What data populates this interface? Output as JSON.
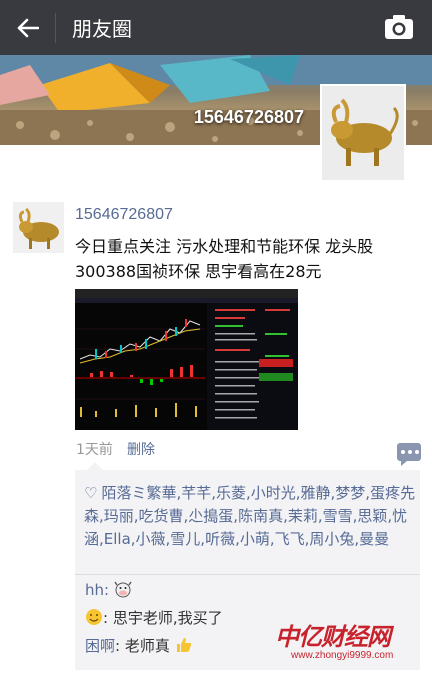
{
  "header": {
    "title": "朋友圈",
    "back_icon": "back-arrow-icon",
    "camera_icon": "camera-icon"
  },
  "cover": {
    "name": "15646726807"
  },
  "post": {
    "username": "15646726807",
    "content": "今日重点关注 污水处理和节能环保 龙头股300388国祯环保 思宇看高在28元",
    "time": "1天前",
    "delete_label": "删除"
  },
  "likes": {
    "names": "陌落ミ繁華,芊芊,乐菱,小时光,雅静,梦梦,蛋疼先森,玛丽,吃货曹,尐搗蛋,陈南真,茉莉,雪雪,思颖,忧涵,Ella,小薇,雪儿,听薇,小萌,飞飞,周小兔,曼曼"
  },
  "comments": [
    {
      "name": "hh:",
      "text": ""
    },
    {
      "name": "",
      "text": ": 思宇老师,我买了"
    },
    {
      "name": "困啊",
      "text": ": 老师真"
    }
  ],
  "watermark": {
    "logo": "中亿财经网",
    "url": "www.zhongyi9999.com"
  },
  "colors": {
    "header_bg": "#393a3f",
    "link": "#576b95",
    "interact_bg": "#f3f3f5"
  }
}
